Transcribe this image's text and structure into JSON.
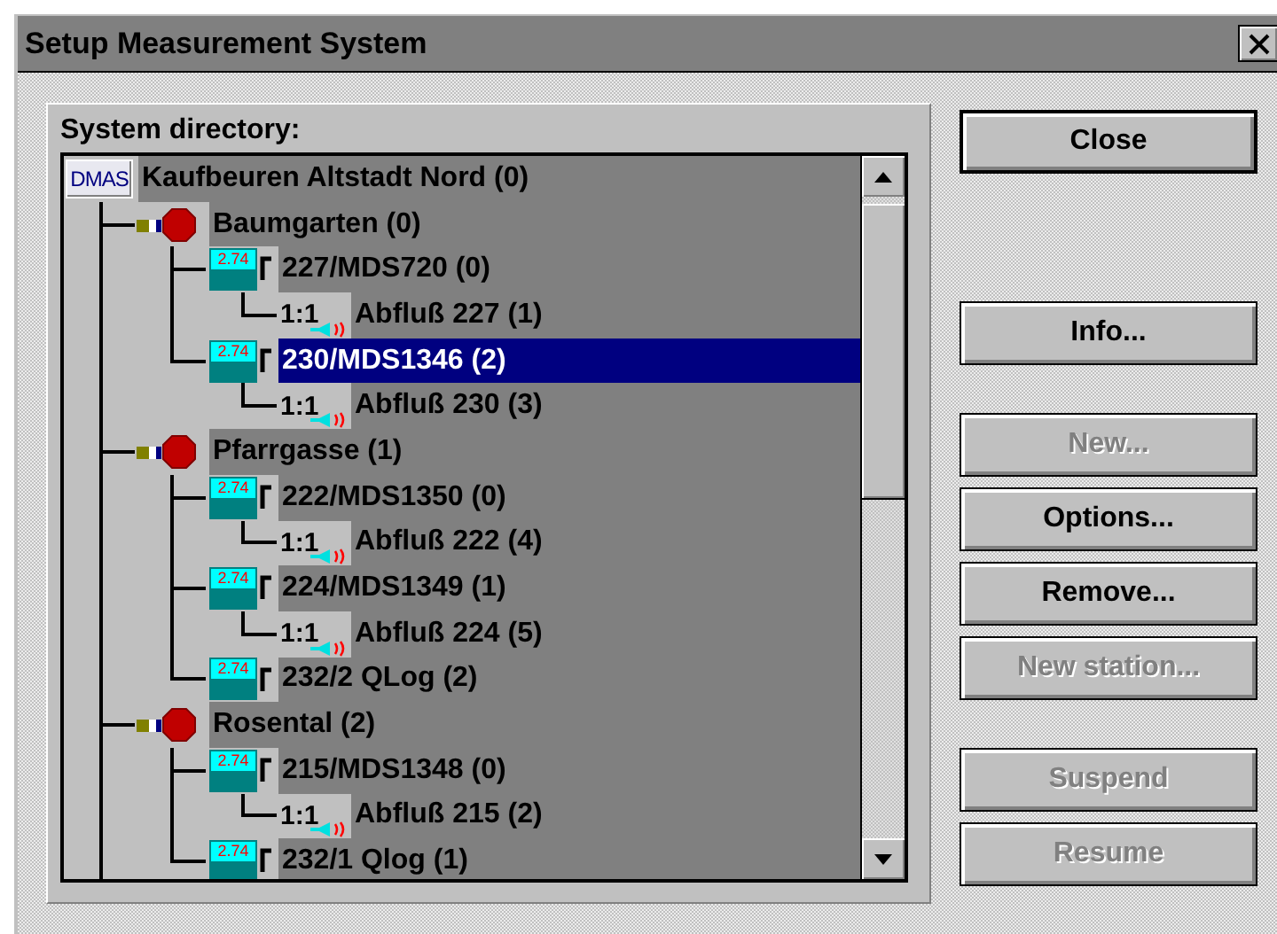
{
  "window": {
    "title": "Setup Measurement System"
  },
  "directory": {
    "label": "System directory:",
    "more_below": true,
    "tree": [
      {
        "kind": "root",
        "logo": "DMAS",
        "label": "Kaufbeuren Altstadt Nord (0)",
        "selected": false,
        "children": [
          {
            "kind": "site",
            "label": "Baumgarten (0)",
            "selected": false,
            "children": [
              {
                "kind": "station",
                "badge": "2.74",
                "label": "227/MDS720 (0)",
                "selected": false,
                "children": [
                  {
                    "kind": "channel",
                    "ratio": "1:1",
                    "label": "Abfluß 227 (1)",
                    "selected": false
                  }
                ]
              },
              {
                "kind": "station",
                "badge": "2.74",
                "label": "230/MDS1346 (2)",
                "selected": true,
                "children": [
                  {
                    "kind": "channel",
                    "ratio": "1:1",
                    "label": "Abfluß 230 (3)",
                    "selected": false
                  }
                ]
              }
            ]
          },
          {
            "kind": "site",
            "label": "Pfarrgasse (1)",
            "selected": false,
            "children": [
              {
                "kind": "station",
                "badge": "2.74",
                "label": "222/MDS1350 (0)",
                "selected": false,
                "children": [
                  {
                    "kind": "channel",
                    "ratio": "1:1",
                    "label": "Abfluß 222 (4)",
                    "selected": false
                  }
                ]
              },
              {
                "kind": "station",
                "badge": "2.74",
                "label": "224/MDS1349 (1)",
                "selected": false,
                "children": [
                  {
                    "kind": "channel",
                    "ratio": "1:1",
                    "label": "Abfluß 224 (5)",
                    "selected": false
                  }
                ]
              },
              {
                "kind": "station",
                "badge": "2.74",
                "label": "232/2 QLog (2)",
                "selected": false
              }
            ]
          },
          {
            "kind": "site",
            "label": "Rosental (2)",
            "selected": false,
            "children": [
              {
                "kind": "station",
                "badge": "2.74",
                "label": "215/MDS1348 (0)",
                "selected": false,
                "children": [
                  {
                    "kind": "channel",
                    "ratio": "1:1",
                    "label": "Abfluß 215 (2)",
                    "selected": false
                  }
                ]
              },
              {
                "kind": "station",
                "badge": "2.74",
                "label": "232/1 Qlog (1)",
                "selected": false
              }
            ]
          }
        ]
      }
    ]
  },
  "button_groups": [
    [
      {
        "label": "Close",
        "default": true,
        "disabled": false
      }
    ],
    [
      {
        "label": "Info...",
        "default": false,
        "disabled": false
      }
    ],
    [
      {
        "label": "New...",
        "default": false,
        "disabled": true
      },
      {
        "label": "Options...",
        "default": false,
        "disabled": false
      },
      {
        "label": "Remove...",
        "default": false,
        "disabled": false
      },
      {
        "label": "New station...",
        "default": false,
        "disabled": true
      }
    ],
    [
      {
        "label": "Suspend",
        "default": false,
        "disabled": true
      },
      {
        "label": "Resume",
        "default": false,
        "disabled": true
      }
    ]
  ]
}
